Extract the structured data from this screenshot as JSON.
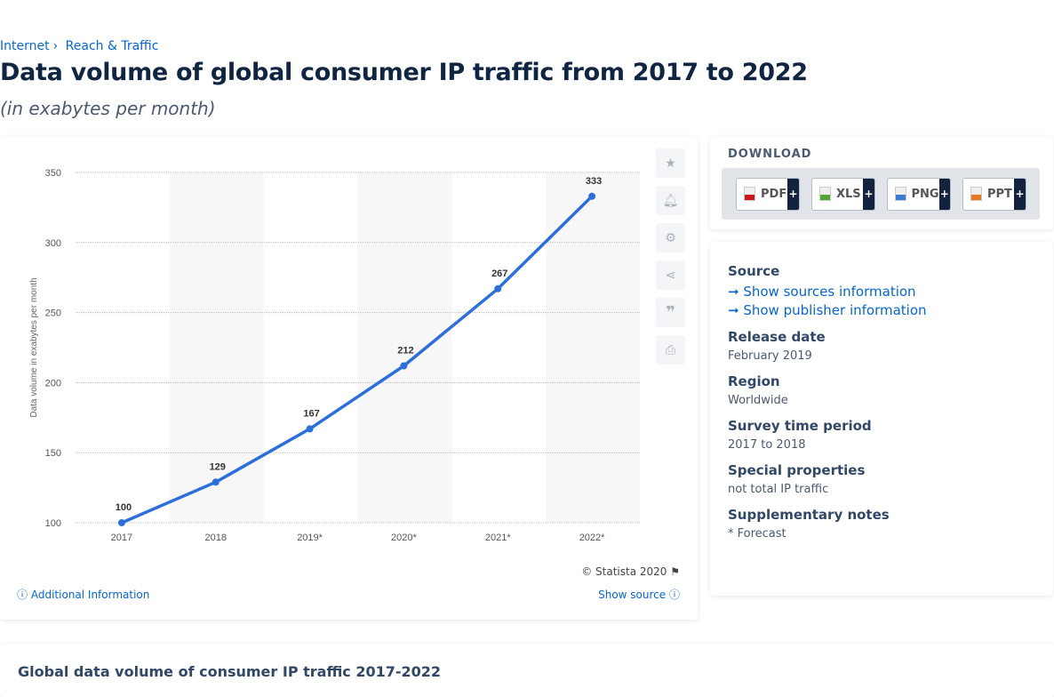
{
  "breadcrumb": [
    "Internet",
    "Reach & Traffic"
  ],
  "title": "Data volume of global consumer IP traffic from 2017 to 2022",
  "subtitle": "(in exabytes per month)",
  "chart_data": {
    "type": "line",
    "categories": [
      "2017",
      "2018",
      "2019*",
      "2020*",
      "2021*",
      "2022*"
    ],
    "values": [
      100,
      129,
      167,
      212,
      267,
      333
    ],
    "ylabel": "Data volume in exabytes per month",
    "ylim": [
      100,
      350
    ],
    "yticks": [
      100,
      150,
      200,
      250,
      300,
      350
    ],
    "grid": true,
    "color": "#2c6fdb"
  },
  "chart_tools": [
    "star-icon",
    "bell-icon",
    "gear-icon",
    "share-icon",
    "quote-icon",
    "print-icon"
  ],
  "copyright": "© Statista 2020",
  "additional_info": "Additional Information",
  "show_source": "Show source",
  "download": {
    "title": "DOWNLOAD",
    "buttons": [
      {
        "label": "PDF",
        "color": "#c8161d"
      },
      {
        "label": "XLS",
        "color": "#52a534"
      },
      {
        "label": "PNG",
        "color": "#3a7bd5"
      },
      {
        "label": "PPT",
        "color": "#e87722"
      }
    ],
    "plus": "+"
  },
  "info": {
    "source_title": "Source",
    "source_link": "➞ Show sources information",
    "publisher_link": "➞ Show publisher information",
    "fields": [
      {
        "label": "Release date",
        "value": "February 2019"
      },
      {
        "label": "Region",
        "value": "Worldwide"
      },
      {
        "label": "Survey time period",
        "value": "2017 to 2018"
      },
      {
        "label": "Special properties",
        "value": "not total IP traffic"
      },
      {
        "label": "Supplementary notes",
        "value": "* Forecast"
      }
    ]
  },
  "bottom_title": "Global data volume of consumer IP traffic 2017-2022"
}
